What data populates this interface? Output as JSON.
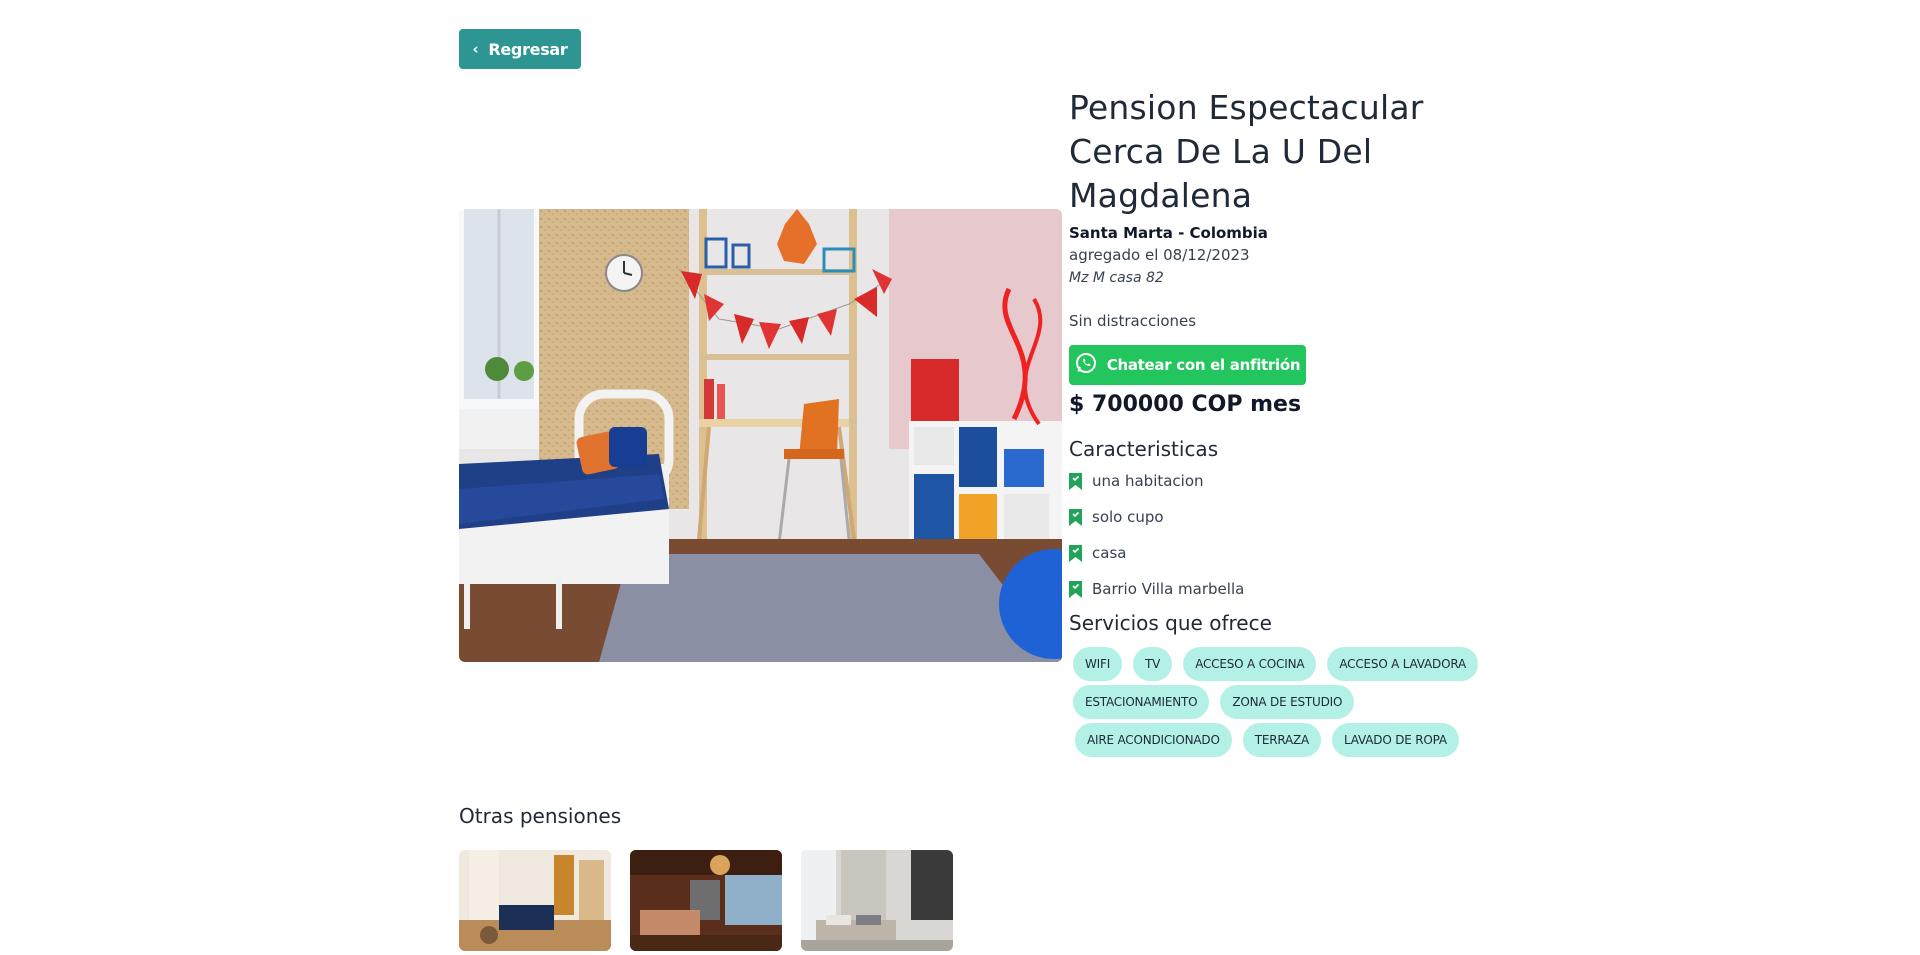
{
  "back_button": {
    "label": "Regresar",
    "icon": "chevron-left-icon"
  },
  "listing": {
    "title": "Pension Espectacular Cerca De La U Del Magdalena",
    "location": "Santa Marta - Colombia",
    "added": "agregado el 08/12/2023",
    "address": "Mz M casa 82",
    "description": "Sin distracciones",
    "chat_button": "Chatear con el anfitrión",
    "price": "$ 700000 COP mes"
  },
  "features": {
    "title": "Caracteristicas",
    "items": [
      "una habitacion",
      "solo cupo",
      "casa",
      "Barrio Villa marbella"
    ]
  },
  "services": {
    "title": "Servicios que ofrece",
    "items": [
      "WIFI",
      "TV",
      "ACCESO A COCINA",
      "ACCESO A LAVADORA",
      "ESTACIONAMIENTO",
      "ZONA DE ESTUDIO",
      "AIRE ACONDICIONADO",
      "TERRAZA",
      "LAVADO DE ROPA"
    ]
  },
  "others": {
    "title": "Otras pensiones"
  },
  "colors": {
    "primary": "#2e9692",
    "whatsapp": "#22c55e",
    "chip": "#b3f1e6",
    "bookmark": "#22a35a"
  }
}
